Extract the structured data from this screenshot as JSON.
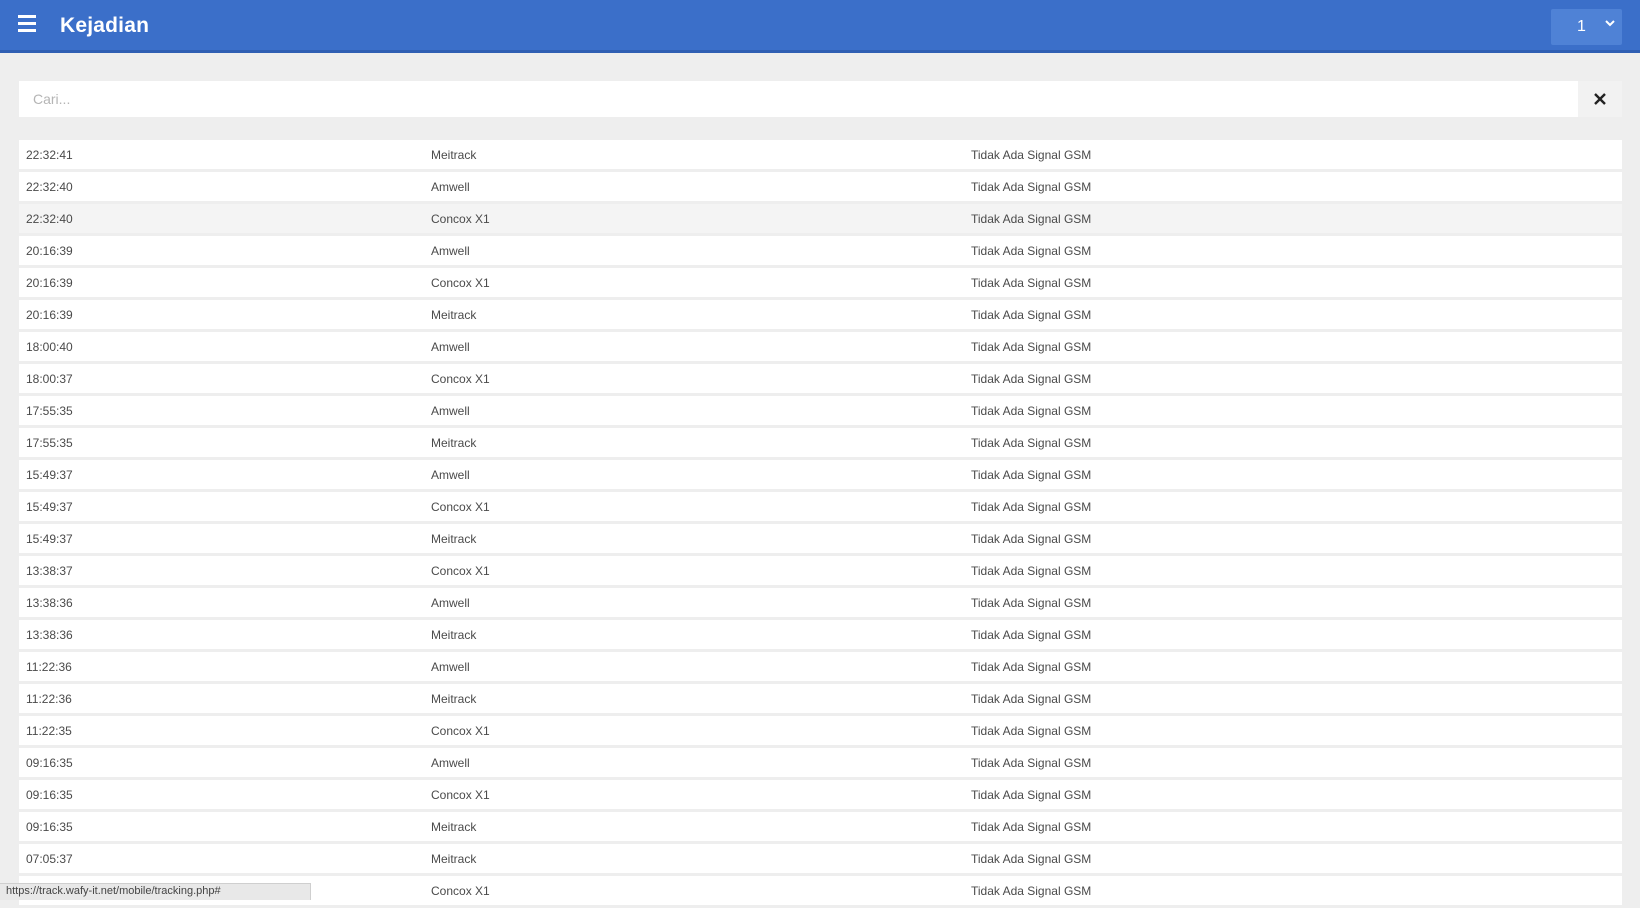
{
  "header": {
    "title": "Kejadian",
    "page_select_value": "1"
  },
  "search": {
    "placeholder": "Cari..."
  },
  "events": [
    {
      "time": "22:32:41",
      "device": "Meitrack",
      "event": "Tidak Ada Signal GSM"
    },
    {
      "time": "22:32:40",
      "device": "Amwell",
      "event": "Tidak Ada Signal GSM"
    },
    {
      "time": "22:32:40",
      "device": "Concox X1",
      "event": "Tidak Ada Signal GSM"
    },
    {
      "time": "20:16:39",
      "device": "Amwell",
      "event": "Tidak Ada Signal GSM"
    },
    {
      "time": "20:16:39",
      "device": "Concox X1",
      "event": "Tidak Ada Signal GSM"
    },
    {
      "time": "20:16:39",
      "device": "Meitrack",
      "event": "Tidak Ada Signal GSM"
    },
    {
      "time": "18:00:40",
      "device": "Amwell",
      "event": "Tidak Ada Signal GSM"
    },
    {
      "time": "18:00:37",
      "device": "Concox X1",
      "event": "Tidak Ada Signal GSM"
    },
    {
      "time": "17:55:35",
      "device": "Amwell",
      "event": "Tidak Ada Signal GSM"
    },
    {
      "time": "17:55:35",
      "device": "Meitrack",
      "event": "Tidak Ada Signal GSM"
    },
    {
      "time": "15:49:37",
      "device": "Amwell",
      "event": "Tidak Ada Signal GSM"
    },
    {
      "time": "15:49:37",
      "device": "Concox X1",
      "event": "Tidak Ada Signal GSM"
    },
    {
      "time": "15:49:37",
      "device": "Meitrack",
      "event": "Tidak Ada Signal GSM"
    },
    {
      "time": "13:38:37",
      "device": "Concox X1",
      "event": "Tidak Ada Signal GSM"
    },
    {
      "time": "13:38:36",
      "device": "Amwell",
      "event": "Tidak Ada Signal GSM"
    },
    {
      "time": "13:38:36",
      "device": "Meitrack",
      "event": "Tidak Ada Signal GSM"
    },
    {
      "time": "11:22:36",
      "device": "Amwell",
      "event": "Tidak Ada Signal GSM"
    },
    {
      "time": "11:22:36",
      "device": "Meitrack",
      "event": "Tidak Ada Signal GSM"
    },
    {
      "time": "11:22:35",
      "device": "Concox X1",
      "event": "Tidak Ada Signal GSM"
    },
    {
      "time": "09:16:35",
      "device": "Amwell",
      "event": "Tidak Ada Signal GSM"
    },
    {
      "time": "09:16:35",
      "device": "Concox X1",
      "event": "Tidak Ada Signal GSM"
    },
    {
      "time": "09:16:35",
      "device": "Meitrack",
      "event": "Tidak Ada Signal GSM"
    },
    {
      "time": "07:05:37",
      "device": "Meitrack",
      "event": "Tidak Ada Signal GSM"
    },
    {
      "time": "",
      "device": "Concox X1",
      "event": "Tidak Ada Signal GSM"
    }
  ],
  "status_bar": {
    "url": "https://track.wafy-it.net/mobile/tracking.php#"
  },
  "colors": {
    "header_bg": "#3b6fc9",
    "page_bg": "#eeeeee",
    "highlight_row": "#f4f4f4"
  },
  "icons": {
    "menu": "hamburger-menu-icon",
    "dropdown": "chevron-down-icon",
    "clear": "close-icon"
  }
}
